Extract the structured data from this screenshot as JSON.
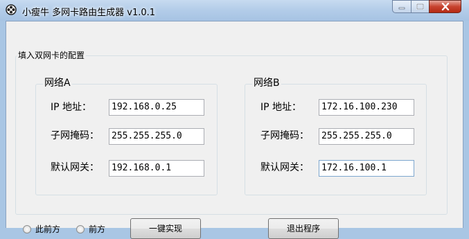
{
  "window": {
    "title": "小瘦牛 多网卡路由生成器 v1.0.1",
    "controls": {
      "minimize": "−",
      "maximize": "□",
      "close": "✕"
    }
  },
  "config_group": {
    "title": "填入双网卡的配置"
  },
  "network_a": {
    "title": "网络A",
    "ip_label": "IP  地址：",
    "ip_value": "192.168.0.25",
    "mask_label": "子网掩码：",
    "mask_value": "255.255.255.0",
    "gateway_label": "默认网关：",
    "gateway_value": "192.168.0.1"
  },
  "network_b": {
    "title": "网络B",
    "ip_label": "IP  地址：",
    "ip_value": "172.16.100.230",
    "mask_label": "子网掩码：",
    "mask_value": "255.255.255.0",
    "gateway_label": "默认网关：",
    "gateway_value": "172.16.100.1"
  },
  "options": {
    "radio1_label": "此前方",
    "radio2_label": "前方"
  },
  "buttons": {
    "generate_label": "一键实现",
    "exit_label": "退出程序"
  },
  "colors": {
    "close_button": "#c7432f",
    "window_frame": "#a9c6e4",
    "client_bg": "#f0f0f0"
  }
}
